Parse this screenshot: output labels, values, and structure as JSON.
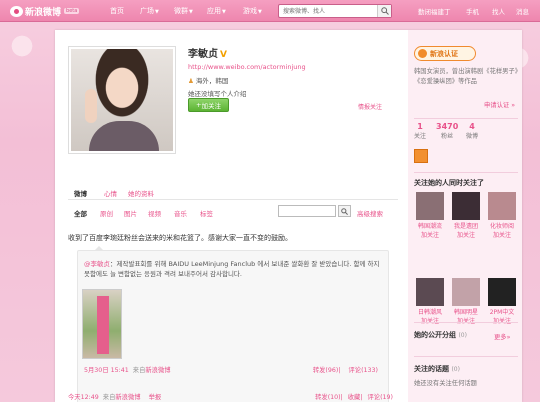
{
  "topbar": {
    "logo_text": "新浪微博",
    "beta_label": "beta",
    "nav": [
      "首页",
      "广场",
      "微群",
      "应用",
      "游戏"
    ],
    "search_placeholder": "搜索微博、找人",
    "links": [
      "勤闭福建丁",
      "手机",
      "找人",
      "消息"
    ]
  },
  "profile": {
    "name": "李敏贞",
    "url": "http://www.weibo.com/actorminjung",
    "location": "海外，韩国",
    "bio": "她还没填写个人介绍",
    "follow_label": "加关注",
    "report_label": "情报关注"
  },
  "tabs": [
    "微博",
    "心情",
    "她的资料"
  ],
  "filters": [
    "全部",
    "原创",
    "图片",
    "视频",
    "音乐",
    "标签"
  ],
  "advanced_search": "高级搜索",
  "post": {
    "text": "收到了百度李琬廷粉丝会送来的米和花篮了。感谢大家一直不变的鼓励。",
    "quote": {
      "author": "@李敏贞",
      "text": "제작발표회를 위해 BAIDU LeeMinjung Fanclub 에서 보내준 쌀화환 잘 받았습니다. 함께 하지 못함에도 늘 변함없는 응원과 격려 보내주어서 감사합니다.",
      "time": "5月30日 15:41",
      "via_prefix": "来自",
      "via_link": "新浪微博",
      "actions": [
        "转发(96)",
        "评论(133)"
      ]
    },
    "time": "今天12:49",
    "via_prefix": "来自",
    "via_link": "新浪微博",
    "report": "举报",
    "actions": [
      "转发(10)",
      "收藏",
      "评论(19)"
    ]
  },
  "sidebar": {
    "auth_label": "新浪认证",
    "auth_text": "韩国女演员，曾出演韩剧《花样男子》《恋爱操纵团》等作品",
    "apply_auth": "申请认证 »",
    "stats": [
      {
        "n": "1",
        "l": "关注"
      },
      {
        "n": "3470",
        "l": "粉丝"
      },
      {
        "n": "4",
        "l": "微博"
      }
    ],
    "following_title": "关注她的人同时关注了",
    "following": [
      {
        "name": "韩国潮流",
        "add": "加关注"
      },
      {
        "name": "我是遗团",
        "add": "加关注"
      },
      {
        "name": "化妆师阅",
        "add": "加关注"
      },
      {
        "name": "日韩潮风",
        "add": "加关注"
      },
      {
        "name": "韩国明星",
        "add": "加关注"
      },
      {
        "name": "2PM中文",
        "add": "加关注"
      }
    ],
    "more": "更多»",
    "groups_title": "她的公开分组",
    "groups_count": "(0)",
    "topics_title": "关注的话题",
    "topics_count": "(0)",
    "topics_text": "她还没有关注任何话题"
  },
  "colors": {
    "accent": "#e8528a",
    "bg": "#f5c9dc"
  }
}
